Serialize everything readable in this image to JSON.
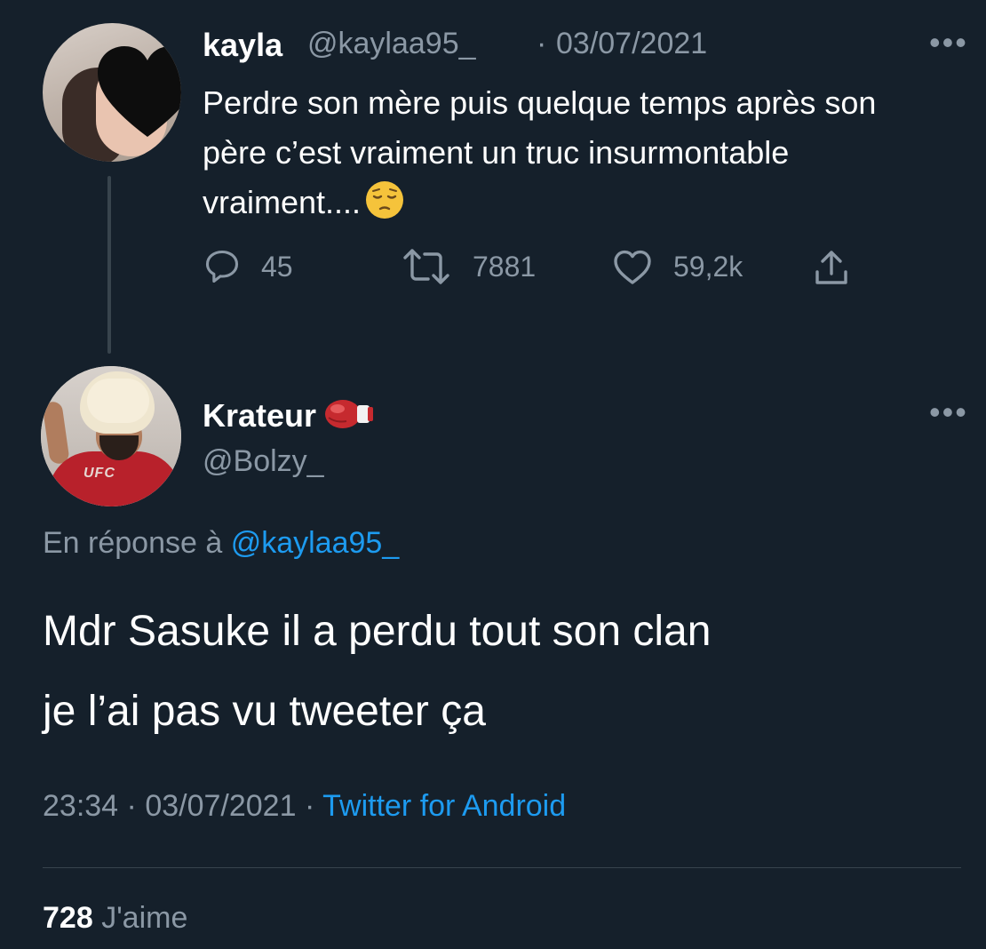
{
  "parent_tweet": {
    "display_name": "kayla",
    "handle": "@kaylaa95_",
    "separator": "·",
    "date": "03/07/2021",
    "more_icon": "more-horizontal-icon",
    "text": "Perdre son mère puis quelque temps après son père c’est vraiment un truc insurmontable vraiment....",
    "emoji": "pensive-face-emoji",
    "actions": {
      "replies": "45",
      "retweets": "7881",
      "likes": "59,2k"
    }
  },
  "reply_tweet": {
    "display_name": "Krateur",
    "name_emoji": "boxing-glove-emoji",
    "handle": "@Bolzy_",
    "more_icon": "more-horizontal-icon",
    "reply_prefix": "En réponse à",
    "reply_to": "@kaylaa95_",
    "text_line1": "Mdr Sasuke il a perdu tout son clan",
    "text_line2": "je l’ai pas vu tweeter ça",
    "time": "23:34",
    "separator": "·",
    "date": "03/07/2021",
    "source": "Twitter for Android",
    "like_count": "728",
    "like_label": "J'aime"
  },
  "colors": {
    "background": "#15202b",
    "text_primary": "#ffffff",
    "text_secondary": "#8b98a5",
    "link": "#1d9bf0",
    "divider": "#38444d"
  }
}
